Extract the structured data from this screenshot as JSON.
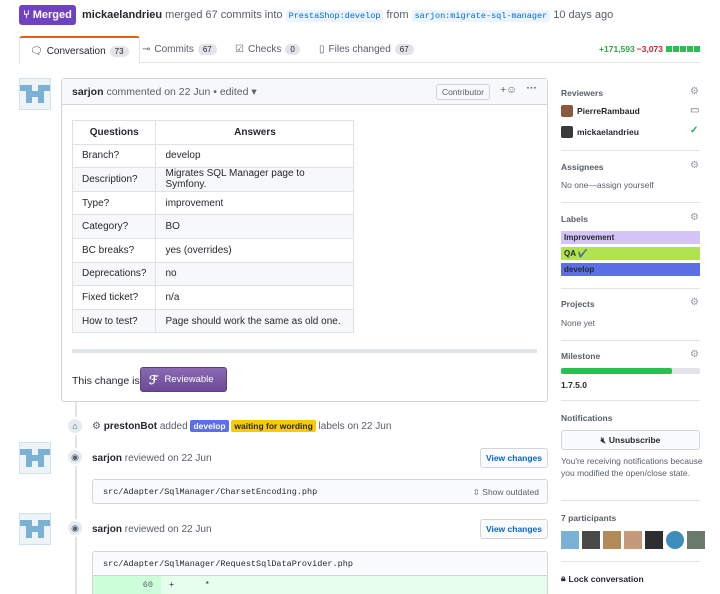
{
  "header": {
    "state": "Merged",
    "author": "mickaelandrieu",
    "merged_text": "merged 67 commits into",
    "base_branch": "PrestaShop:develop",
    "from_text": "from",
    "head_branch": "sarjon:migrate-sql-manager",
    "time": "10 days ago"
  },
  "tabs": [
    {
      "label": "Conversation",
      "count": "73"
    },
    {
      "label": "Commits",
      "count": "67"
    },
    {
      "label": "Checks",
      "count": "0"
    },
    {
      "label": "Files changed",
      "count": "67"
    }
  ],
  "diffstat": {
    "additions": "+171,593",
    "deletions": "−3,073"
  },
  "comment": {
    "author": "sarjon",
    "meta": "commented on 22 Jun • edited",
    "role": "Contributor",
    "table_headers": [
      "Questions",
      "Answers"
    ],
    "rows": [
      [
        "Branch?",
        "develop"
      ],
      [
        "Description?",
        "Migrates SQL Manager page to Symfony."
      ],
      [
        "Type?",
        "improvement"
      ],
      [
        "Category?",
        "BO"
      ],
      [
        "BC breaks?",
        "yes (overrides)"
      ],
      [
        "Deprecations?",
        "no"
      ],
      [
        "Fixed ticket?",
        "n/a"
      ],
      [
        "How to test?",
        "Page should work the same as old one."
      ]
    ],
    "change_text": "This change is",
    "reviewable_label": "Reviewable"
  },
  "timeline": {
    "label_event": {
      "actor": "prestonBot",
      "action": "added",
      "label1": "develop",
      "label2": "waiting for wording",
      "suffix": "labels on 22 Jun"
    },
    "review1": {
      "author": "sarjon",
      "text": "reviewed on 22 Jun",
      "button": "View changes",
      "file": "src/Adapter/SqlManager/CharsetEncoding.php",
      "outdated": "Show outdated"
    },
    "review2": {
      "author": "sarjon",
      "text": "reviewed on 22 Jun",
      "button": "View changes",
      "file": "src/Adapter/SqlManager/RequestSqlDataProvider.php",
      "line_no": "60",
      "line_code": "+      *"
    }
  },
  "sidebar": {
    "reviewers_title": "Reviewers",
    "reviewers": [
      "PierreRambaud",
      "mickaelandrieu"
    ],
    "assignees_title": "Assignees",
    "assignees_text": "No one—assign yourself",
    "labels_title": "Labels",
    "labels": [
      {
        "name": "Improvement",
        "color": "#d4c5f9"
      },
      {
        "name": "QA ✔️",
        "color": "#b1e34f"
      },
      {
        "name": "develop",
        "color": "#5b6fe6"
      }
    ],
    "projects_title": "Projects",
    "projects_text": "None yet",
    "milestone_title": "Milestone",
    "milestone_name": "1.7.5.0",
    "milestone_progress": 0.8,
    "notifications_title": "Notifications",
    "unsubscribe": "Unsubscribe",
    "notify_text": "You're receiving notifications because you modified the open/close state.",
    "participants_title": "7 participants",
    "lock": "Lock conversation"
  },
  "colors": {
    "merged": "#6f42c1",
    "link": "#0366d6",
    "add": "#28a745",
    "del": "#cb2431"
  }
}
